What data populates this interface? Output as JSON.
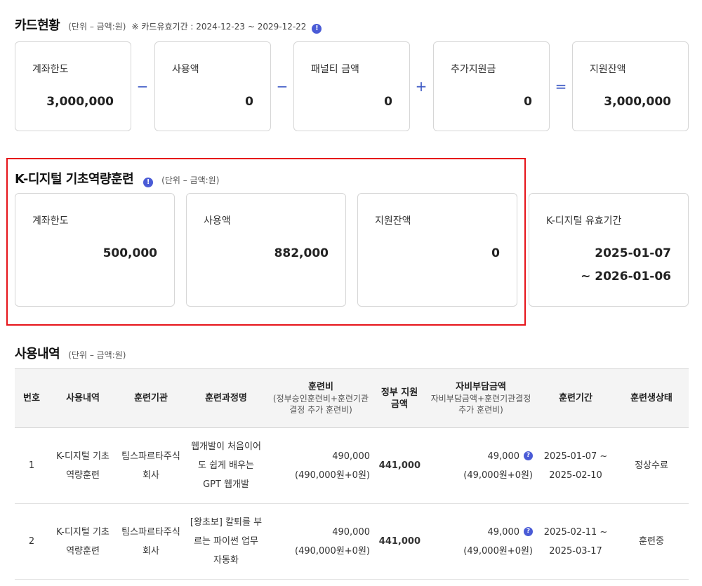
{
  "card_status": {
    "title": "카드현황",
    "unit": "(단위 – 금액:원)",
    "validity": "※ 카드유효기간 : 2024-12-23 ~ 2029-12-22",
    "info_icon": "info-icon",
    "cards": [
      {
        "label": "계좌한도",
        "value": "3,000,000"
      },
      {
        "label": "사용액",
        "value": "0"
      },
      {
        "label": "패널티 금액",
        "value": "0"
      },
      {
        "label": "추가지원금",
        "value": "0"
      },
      {
        "label": "지원잔액",
        "value": "3,000,000"
      }
    ],
    "operators": [
      "−",
      "−",
      "+",
      "="
    ]
  },
  "kdigital": {
    "title": "K-디지털 기초역량훈련",
    "unit": "(단위 – 금액:원)",
    "cards": [
      {
        "label": "계좌한도",
        "value": "500,000"
      },
      {
        "label": "사용액",
        "value": "882,000"
      },
      {
        "label": "지원잔액",
        "value": "0"
      }
    ],
    "validity_card": {
      "label": "K-디지털 유효기간",
      "start": "2025-01-07",
      "end": "~ 2026-01-06"
    }
  },
  "usage": {
    "title": "사용내역",
    "unit": "(단위 – 금액:원)",
    "headers": {
      "no": "번호",
      "type": "사용내역",
      "institution": "훈련기관",
      "course": "훈련과정명",
      "fee": "훈련비",
      "fee_sub": "(정부승인훈련비+훈련기관 결정 추가 훈련비)",
      "gov": "정부 지원금액",
      "self": "자비부담금액",
      "self_sub": "자비부담금액+훈련기관결정 추가 훈련비)",
      "period": "훈련기간",
      "status": "훈련생상태"
    },
    "rows": [
      {
        "no": "1",
        "type": "K-디지털 기초역량훈련",
        "institution": "팀스파르타주식회사",
        "course": "웹개발이 처음이어도 쉽게 배우는 GPT 웹개발",
        "fee": "490,000",
        "fee_detail": "(490,000원+0원)",
        "gov": "441,000",
        "self": "49,000",
        "self_detail": "(49,000원+0원)",
        "period_start": "2025-01-07 ~",
        "period_end": "2025-02-10",
        "status": "정상수료"
      },
      {
        "no": "2",
        "type": "K-디지털 기초역량훈련",
        "institution": "팀스파르타주식회사",
        "course": "[왕초보] 칼퇴를 부르는 파이썬 업무 자동화",
        "fee": "490,000",
        "fee_detail": "(490,000원+0원)",
        "gov": "441,000",
        "self": "49,000",
        "self_detail": "(49,000원+0원)",
        "period_start": "2025-02-11 ~",
        "period_end": "2025-03-17",
        "status": "훈련중"
      }
    ]
  }
}
